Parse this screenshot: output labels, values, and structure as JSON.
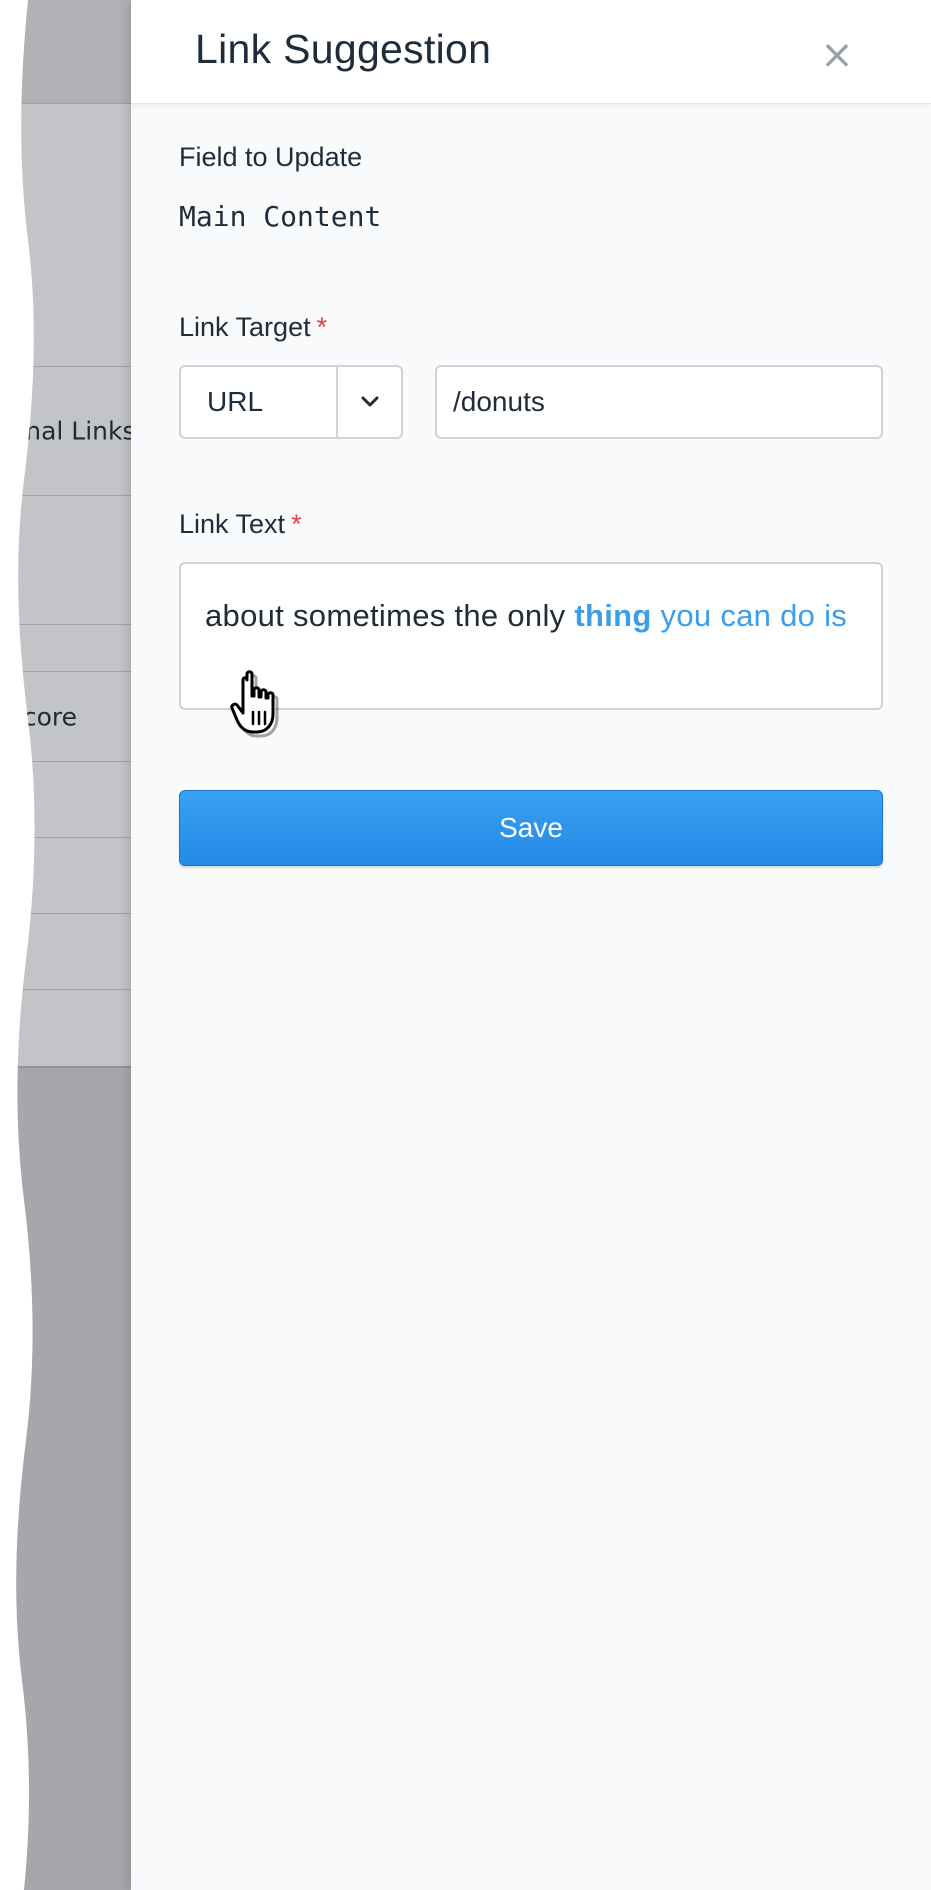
{
  "background": {
    "rows": [
      {
        "label": "ernal Links"
      },
      {
        "label": "Score"
      }
    ]
  },
  "panel": {
    "title": "Link Suggestion",
    "close_label": "×",
    "field_to_update": {
      "label": "Field to Update",
      "value": "Main Content"
    },
    "link_target": {
      "label": "Link Target",
      "required_mark": "*",
      "type_selected": "URL",
      "value": "/donuts"
    },
    "link_text": {
      "label": "Link Text",
      "required_mark": "*",
      "text_before": "about sometimes the only ",
      "text_anchor_bold": "thing",
      "text_anchor_rest": " you can do is"
    },
    "save_label": "Save"
  },
  "colors": {
    "accent": "#2a8fe8",
    "link_highlight": "#3b9eea",
    "required": "#e53e3e"
  },
  "icons": {
    "close": "close-icon",
    "select_chevron": "chevron-down-icon",
    "cursor": "hand-pointer-cursor-icon"
  }
}
